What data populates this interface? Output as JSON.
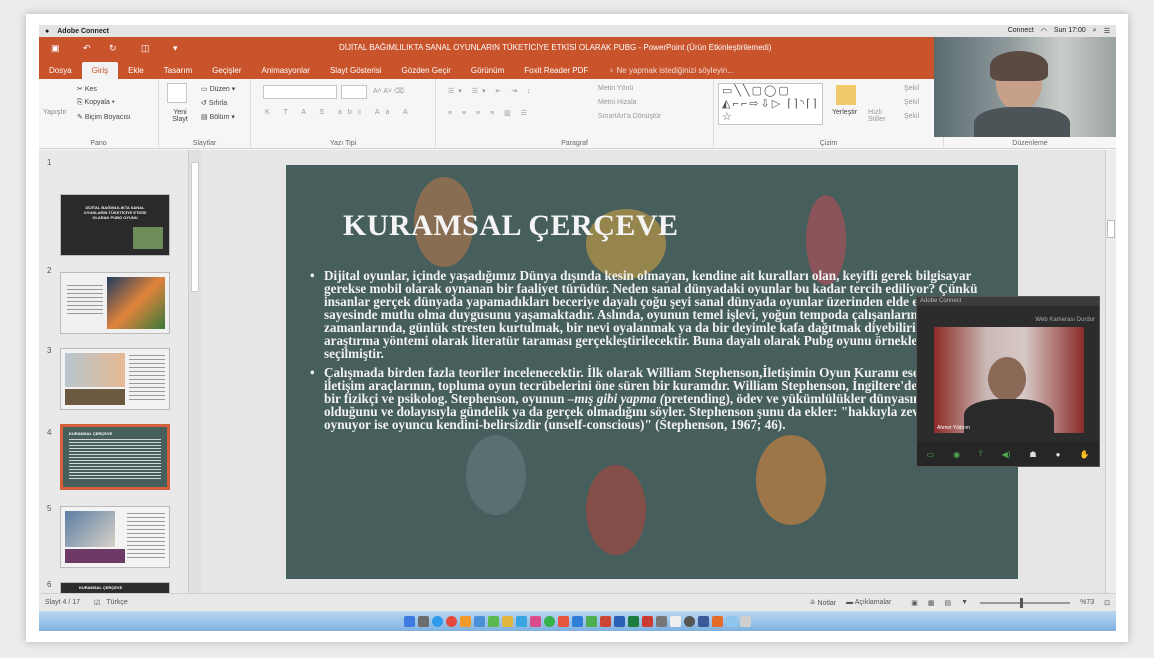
{
  "mac_bar": {
    "app": "Adobe Connect",
    "right": [
      "Connect",
      "Sun 17:00"
    ]
  },
  "title_bar": {
    "doc_title": "DİJİTAL BAĞIMLILIKTA SANAL OYUNLARIN TÜKETİCİYE ETKİSİ OLARAK PUBG - PowerPoint (Ürün Etkinleştirilemedi)"
  },
  "tabs": [
    "Dosya",
    "Giriş",
    "Ekle",
    "Tasarım",
    "Geçişler",
    "Animasyonlar",
    "Slayt Gösterisi",
    "Gözden Geçir",
    "Görünüm",
    "Foxit Reader PDF"
  ],
  "active_tab": "Giriş",
  "tell_me": "Ne yapmak istediğinizi söyleyin...",
  "ribbon": {
    "pano": {
      "paste": "Yapıştır",
      "cut": "Kes",
      "copy": "Kopyala",
      "format_painter": "Biçim Boyacısı",
      "label": "Pano"
    },
    "slaytlar": {
      "new_slide": "Yeni Slayt",
      "layout": "Düzen",
      "reset": "Sıfırla",
      "section": "Bölüm",
      "label": "Slaytlar"
    },
    "yazi_tipi": {
      "label": "Yazı Tipi"
    },
    "paragraf": {
      "text_direction": "Metin Yönü",
      "align_text": "Metni Hizala",
      "smartart": "SmartArt'a Dönüştür",
      "label": "Paragraf"
    },
    "cizim": {
      "arrange": "Yerleştir",
      "quick_styles": "Hızlı Stiller",
      "shape_fill": "Şekil",
      "label": "Çizim"
    },
    "duzenleme": {
      "label": "Düzenleme"
    }
  },
  "slides": [
    {
      "num": "1",
      "caption": "DİJİTAL BAĞIMLILIKTA SANAL OYUNLARIN TÜKETİCİYE ETKİSİ OLARAK PUBG OYUNU"
    },
    {
      "num": "2",
      "caption": ""
    },
    {
      "num": "3",
      "caption": ""
    },
    {
      "num": "4",
      "caption": "KURAMSAL ÇERÇEVE"
    },
    {
      "num": "5",
      "caption": ""
    },
    {
      "num": "6",
      "caption": "KURAMSAL ÇERÇEVE"
    }
  ],
  "slide": {
    "title": "KURAMSAL ÇERÇEVE",
    "bullet1": "Dijital oyunlar, içinde yaşadığımız Dünya dışında kesin olmayan, kendine ait kuralları olan, keyifli gerek bilgisayar gerekse mobil olarak oynanan bir faaliyet türüdür. Neden sanal dünyadaki oyunlar bu kadar tercih ediliyor? Çünkü insanlar gerçek dünyada yapamadıkları beceriye dayalı çoğu şeyi sanal dünyada oyunlar üzerinden elde ettikleri başarı sayesinde mutlu olma duygusunu yaşamaktadır. Aslında, oyunun temel işlevi, yoğun tempoda çalışanların boş kalan zamanlarında, günlük stresten kurtulmak, bir nevi oyalanmak ya da bir deyimle kafa dağıtmak diyebiliriz. Bu makalede araştırma yöntemi olarak literatür taraması gerçekleştirilecektir. Buna dayalı olarak Pubg oyunu örneklem olarak seçilmiştir.",
    "bullet2_a": "Çalışmada birden fazla teoriler incelenecektir. İlk olarak William Stephenson,İletişimin Oyun Kuramı eserinde kitle iletişim araçlarının, topluma oyun tecrübelerini öne süren bir kuramdır. William Stephenson, İngiltere'de doğmuş ünlü bir fizikçi ve psikolog. Stephenson, oyunun ",
    "bullet2_em": "–mış gibi yapma (",
    "bullet2_b": "pretending), ödev ve yükümlülükler dünyasının dışına çıkma olduğunu ve dolayısıyla gündelik ya da gerçek olmadığını söyler. Stephenson şunu da ekler: \"hakkıyla zevk alarak oynuyor ise oyuncu kendini-belirsizdir (unself-conscious)\" (Stephenson, 1967; 46)."
  },
  "video_panel": {
    "header": "Adobe Connect",
    "label": "Web Kamerası Durdur",
    "name": "Ahmet Yıldırım"
  },
  "status": {
    "slide": "Slayt 4 / 17",
    "lang": "Türkçe",
    "notes": "Notlar",
    "comments": "Açıklamalar",
    "zoom": "%73"
  },
  "colors": {
    "accent": "#c9532b",
    "slide_bg": "#465e5c",
    "selected": "#d4603a"
  }
}
